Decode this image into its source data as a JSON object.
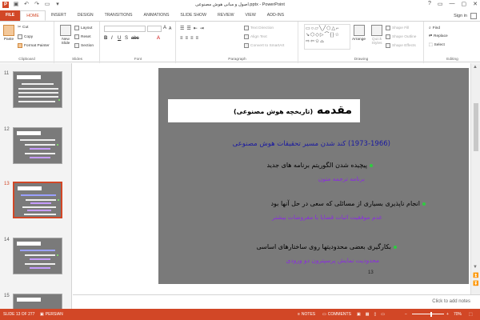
{
  "window": {
    "title": "اصول و مبانی هوش مصنوعی.pptx - PowerPoint",
    "controls": [
      "?",
      "—",
      "▢",
      "✕"
    ],
    "signin": "Sign in"
  },
  "tabs": [
    "FILE",
    "HOME",
    "INSERT",
    "DESIGN",
    "TRANSITIONS",
    "ANIMATIONS",
    "SLIDE SHOW",
    "REVIEW",
    "VIEW",
    "ADD-INS"
  ],
  "ribbon": {
    "clipboard": {
      "paste": "Paste",
      "cut": "Cut",
      "copy": "Copy",
      "format_painter": "Format Painter",
      "label": "Clipboard"
    },
    "slides": {
      "new_slide": "New Slide",
      "layout": "Layout",
      "reset": "Reset",
      "section": "Section",
      "label": "Slides"
    },
    "font": {
      "label": "Font"
    },
    "paragraph": {
      "text_direction": "Text Direction",
      "align_text": "Align Text",
      "convert_smartart": "Convert to SmartArt",
      "label": "Paragraph"
    },
    "drawing": {
      "arrange": "Arrange",
      "quick_styles": "Quick Styles",
      "shape_fill": "Shape Fill",
      "shape_outline": "Shape Outline",
      "shape_effects": "Shape Effects",
      "label": "Drawing"
    },
    "editing": {
      "find": "Find",
      "replace": "Replace",
      "select": "Select",
      "label": "Editing"
    }
  },
  "thumbnails": [
    {
      "number": "11"
    },
    {
      "number": "12"
    },
    {
      "number": "13"
    },
    {
      "number": "14"
    },
    {
      "number": "15"
    }
  ],
  "slide": {
    "title": "مقدمه",
    "title_suffix": "(تاریخچه هوش مصنوعی)",
    "subtitle": "(1973-1966) کند شدن مسیر تحقیقات هوش مصنوعی",
    "bullets": [
      {
        "text": "پیچیده شدن الگوریتم برنامه های جدید",
        "sub": "برنامه ترجمه متون"
      },
      {
        "text": "انجام ناپذیری بسیاری از مسائلی که سعی در حل آنها بود",
        "sub": "عدم موفقیت اثبات قضایا با مفروضات بیشتر"
      },
      {
        "text": "بکارگیری بعضی محدودیتها روی ساختارهای اساسی",
        "sub": "محدودیت نمایش پرسپترون دو ورودی"
      }
    ],
    "number": "13"
  },
  "notes_placeholder": "Click to add notes",
  "status": {
    "slide_info": "SLIDE 13 OF 277",
    "language": "PERSIAN",
    "notes": "NOTES",
    "comments": "COMMENTS",
    "zoom": "70%"
  }
}
